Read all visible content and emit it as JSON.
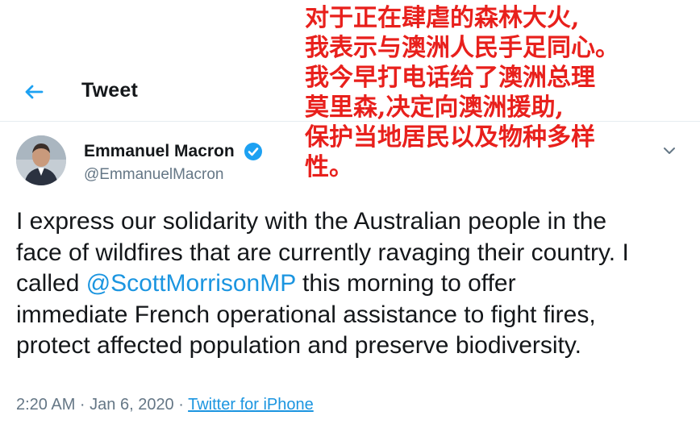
{
  "header": {
    "title": "Tweet"
  },
  "tweet": {
    "author_name": "Emmanuel Macron",
    "author_handle": "@EmmanuelMacron",
    "text_lines": [
      "I express our solidarity with the Australian people in the",
      "face of wildfires that are currently ravaging their country. I",
      "called ",
      "immediate French operational assistance to fight fires,",
      "protect affected population and preserve biodiversity."
    ],
    "mention": "@ScottMorrisonMP",
    "line3_tail": " this morning to offer",
    "timestamp": "2:20 AM · Jan 6, 2020 · ",
    "source": "Twitter for iPhone"
  },
  "overlay_translation": {
    "lines": [
      "对于正在肆虐的森林大火,",
      "我表示与澳洲人民手足同心。",
      "我今早打电话给了澳洲总理",
      "莫里森,决定向澳洲援助,",
      "保护当地居民以及物种多样",
      "性。"
    ],
    "color": "#e8201c"
  },
  "icons": {
    "back": "arrow-left-icon",
    "verified": "verified-badge-icon",
    "more": "chevron-down-icon"
  },
  "colors": {
    "accent": "#1da1f2",
    "link": "#1b95e0",
    "secondary_text": "#657786"
  }
}
